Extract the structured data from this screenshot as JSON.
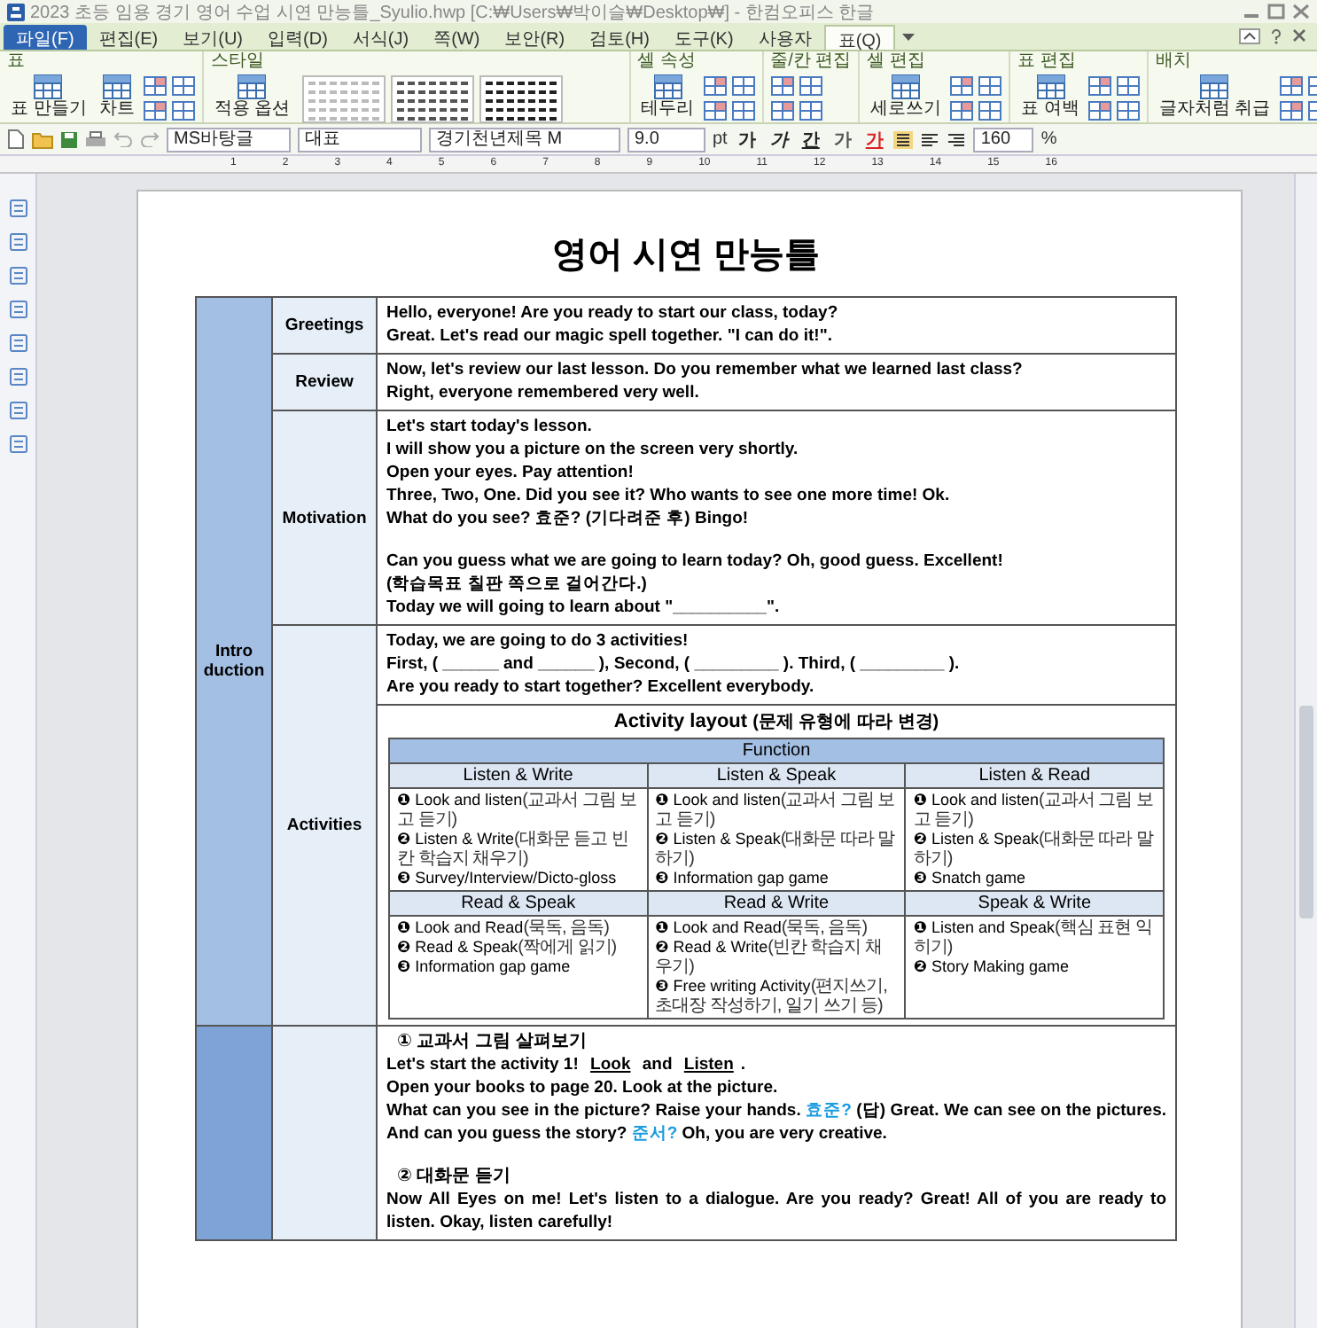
{
  "window": {
    "title": "2023 초등 임용 경기 영어 수업 시연 만능틀_Syulio.hwp [C:₩Users₩박이슬₩Desktop₩] - 한컴오피스 한글"
  },
  "menu": [
    {
      "label": "파일(F)",
      "kind": "file",
      "selected": false
    },
    {
      "label": "편집(E)",
      "kind": "tab",
      "selected": false
    },
    {
      "label": "보기(U)",
      "kind": "tab",
      "selected": false
    },
    {
      "label": "입력(D)",
      "kind": "tab",
      "selected": false
    },
    {
      "label": "서식(J)",
      "kind": "tab",
      "selected": false
    },
    {
      "label": "쪽(W)",
      "kind": "tab",
      "selected": false
    },
    {
      "label": "보안(R)",
      "kind": "tab",
      "selected": false
    },
    {
      "label": "검토(H)",
      "kind": "tab",
      "selected": false
    },
    {
      "label": "도구(K)",
      "kind": "tab",
      "selected": false
    },
    {
      "label": "사용자",
      "kind": "tab",
      "selected": false
    },
    {
      "label": "표(Q)",
      "kind": "tab",
      "selected": true
    }
  ],
  "ribbon": {
    "groups": [
      {
        "label": "표",
        "buttons": [
          "표 만들기",
          "차트"
        ]
      },
      {
        "label": "스타일",
        "buttons": [
          "적용 옵션"
        ]
      },
      {
        "label": "셀 속성",
        "buttons": [
          "테두리"
        ]
      },
      {
        "label": "줄/칸 편집"
      },
      {
        "label": "셀 편집",
        "buttons": [
          "세로쓰기"
        ]
      },
      {
        "label": "표 편집",
        "buttons": [
          "표 여백"
        ]
      },
      {
        "label": "배치",
        "buttons": [
          "글자처럼 취급"
        ]
      }
    ]
  },
  "toolbar": {
    "style": "MS바탕글",
    "outline": "대표",
    "font": "경기천년제목 M",
    "size": "9.0",
    "unit": "pt",
    "char_buttons": [
      {
        "label": "가",
        "kind": "bold"
      },
      {
        "label": "가",
        "kind": "italic"
      },
      {
        "label": "간",
        "kind": "underline"
      },
      {
        "label": "가",
        "kind": "outline"
      },
      {
        "label": "가",
        "kind": "color"
      }
    ],
    "zoom": "160",
    "zoom_unit": "%"
  },
  "ruler": {
    "marks": [
      "1",
      "2",
      "3",
      "4",
      "5",
      "6",
      "7",
      "8",
      "9",
      "10",
      "11",
      "12",
      "13",
      "14",
      "15",
      "16"
    ]
  },
  "document": {
    "title": "영어 시연 만능틀",
    "sections": [
      {
        "label": "Intro duction",
        "rows": [
          {
            "label": "Greetings",
            "content": [
              {
                "kind": "para",
                "parts": [
                  {
                    "kind": "plain",
                    "text": "Hello, everyone! Are you ready to start our class, today?"
                  }
                ]
              },
              {
                "kind": "para",
                "parts": [
                  {
                    "kind": "plain",
                    "text": "Great. Let's read our magic spell together. \"I can do it!\"."
                  }
                ]
              }
            ]
          },
          {
            "label": "Review",
            "content": [
              {
                "kind": "para",
                "parts": [
                  {
                    "kind": "plain",
                    "text": "Now, let's review our last lesson. Do you remember what we learned last class?"
                  }
                ]
              },
              {
                "kind": "para",
                "parts": [
                  {
                    "kind": "plain",
                    "text": "Right, everyone remembered very well."
                  }
                ]
              }
            ]
          },
          {
            "label": "Motivation",
            "content": [
              {
                "kind": "para",
                "parts": [
                  {
                    "kind": "plain",
                    "text": "Let's start today's lesson."
                  }
                ]
              },
              {
                "kind": "para",
                "parts": [
                  {
                    "kind": "plain",
                    "text": "I will show you a picture on the screen very shortly."
                  }
                ]
              },
              {
                "kind": "para",
                "parts": [
                  {
                    "kind": "plain",
                    "text": "Open your eyes. Pay attention!"
                  }
                ]
              },
              {
                "kind": "para",
                "parts": [
                  {
                    "kind": "plain",
                    "text": "Three, Two, One.  Did you see it? Who wants to see one more time! Ok."
                  }
                ]
              },
              {
                "kind": "para",
                "parts": [
                  {
                    "kind": "plain",
                    "text": "What do you see? 효준? (기다려준 후) Bingo!"
                  }
                ]
              },
              {
                "kind": "spacer"
              },
              {
                "kind": "para",
                "parts": [
                  {
                    "kind": "plain",
                    "text": "Can you guess what we are going to learn today? Oh, good guess. Excellent!"
                  }
                ]
              },
              {
                "kind": "para",
                "parts": [
                  {
                    "kind": "plain",
                    "text": "(학습목표 칠판 쪽으로 걸어간다.)"
                  }
                ]
              },
              {
                "kind": "para",
                "parts": [
                  {
                    "kind": "plain",
                    "text": "Today we will going to learn about \"__________\"."
                  }
                ]
              }
            ]
          },
          {
            "label": "Activities",
            "content": [
              {
                "kind": "para",
                "parts": [
                  {
                    "kind": "plain",
                    "text": "Today, we are going to do 3 activities!"
                  }
                ]
              },
              {
                "kind": "para",
                "parts": [
                  {
                    "kind": "plain",
                    "text": "First, ( ______ and ______ ), Second, ( _________ ). Third, ( _________ )."
                  }
                ]
              },
              {
                "kind": "para",
                "parts": [
                  {
                    "kind": "plain",
                    "text": "Are you ready to start together? Excellent everybody."
                  }
                ]
              },
              {
                "kind": "activity_layout",
                "title": "Activity layout",
                "note": "(문제 유형에 따라 변경)",
                "header": "Function",
                "cells": [
                  {
                    "heading": "Listen & Write",
                    "items": [
                      {
                        "marker": "❶",
                        "text": "Look and listen",
                        "note": "(교과서 그림 보고 듣기)"
                      },
                      {
                        "marker": "❷",
                        "text": "Listen & Write",
                        "note": "(대화문 듣고 빈칸 학습지 채우기)"
                      },
                      {
                        "marker": "❸",
                        "text": "Survey/Interview/Dicto-gloss"
                      }
                    ]
                  },
                  {
                    "heading": "Listen & Speak",
                    "items": [
                      {
                        "marker": "❶",
                        "text": "Look and listen",
                        "note": "(교과서 그림 보고 듣기)"
                      },
                      {
                        "marker": "❷",
                        "text": "Listen & Speak",
                        "note": "(대화문 따라 말하기)"
                      },
                      {
                        "marker": "❸",
                        "text": "Information gap game"
                      }
                    ]
                  },
                  {
                    "heading": "Listen & Read",
                    "items": [
                      {
                        "marker": "❶",
                        "text": "Look and listen",
                        "note": "(교과서 그림 보고 듣기)"
                      },
                      {
                        "marker": "❷",
                        "text": "Listen & Speak",
                        "note": "(대화문 따라 말하기)"
                      },
                      {
                        "marker": "❸",
                        "text": "Snatch game"
                      }
                    ]
                  },
                  {
                    "heading": "Read & Speak",
                    "items": [
                      {
                        "marker": "❶",
                        "text": "Look and Read",
                        "note": "(묵독, 음독)"
                      },
                      {
                        "marker": "❷",
                        "text": "Read & Speak",
                        "note": "(짝에게 읽기)"
                      },
                      {
                        "marker": "❸",
                        "text": "Information gap game"
                      }
                    ]
                  },
                  {
                    "heading": "Read & Write",
                    "items": [
                      {
                        "marker": "❶",
                        "text": "Look and Read",
                        "note": "(묵독, 음독)"
                      },
                      {
                        "marker": "❷",
                        "text": "Read & Write",
                        "note": "(빈칸 학습지 채우기)"
                      },
                      {
                        "marker": "❸",
                        "text": "Free writing Activity",
                        "note": "(편지쓰기, 초대장 작성하기, 일기 쓰기 등)"
                      }
                    ]
                  },
                  {
                    "heading": "Speak & Write",
                    "items": [
                      {
                        "marker": "❶",
                        "text": "Listen and Speak",
                        "note": "(핵심 표현 익히기)"
                      },
                      {
                        "marker": "❷",
                        "text": "Story Making game"
                      }
                    ]
                  }
                ]
              }
            ]
          }
        ]
      },
      {
        "rows": [
          {
            "content": [
              {
                "kind": "heading",
                "text": "① 교과서 그림 살펴보기"
              },
              {
                "kind": "para",
                "parts": [
                  {
                    "kind": "plain",
                    "text": "Let's start the activity 1! "
                  },
                  {
                    "kind": "blank",
                    "text": "Look"
                  },
                  {
                    "kind": "plain",
                    "text": " and "
                  },
                  {
                    "kind": "blank",
                    "text": "Listen"
                  },
                  {
                    "kind": "plain",
                    "text": "."
                  }
                ]
              },
              {
                "kind": "para",
                "parts": [
                  {
                    "kind": "plain",
                    "text": "Open your books to page 20. Look at the picture."
                  }
                ]
              },
              {
                "kind": "para",
                "parts": [
                  {
                    "kind": "plain",
                    "text": "What can you see in the picture? Raise your hands. "
                  },
                  {
                    "kind": "name",
                    "text": "효준?"
                  },
                  {
                    "kind": "plain",
                    "text": " (답) Great. We can see on the pictures. And can you guess the story? "
                  },
                  {
                    "kind": "name",
                    "text": "준서?"
                  },
                  {
                    "kind": "plain",
                    "text": " Oh, you are very creative."
                  }
                ]
              },
              {
                "kind": "spacer"
              },
              {
                "kind": "heading",
                "text": "② 대화문 듣기"
              },
              {
                "kind": "para",
                "parts": [
                  {
                    "kind": "plain",
                    "text": "Now All Eyes on me! Let's listen to a dialogue. Are you ready? Great! All of you are ready to listen. Okay, listen carefully!"
                  }
                ]
              }
            ]
          }
        ]
      }
    ]
  }
}
